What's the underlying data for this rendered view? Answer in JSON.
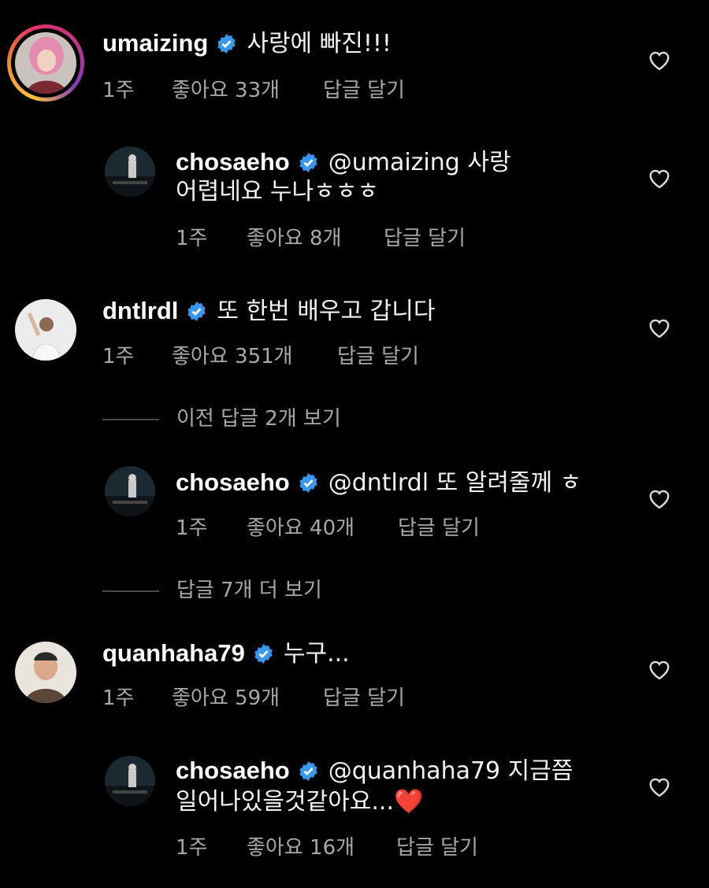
{
  "comments": [
    {
      "username": "umaizing",
      "text": "사랑에 빠진!!!",
      "time": "1주",
      "likes": "좋아요 33개",
      "reply": "답글 달기"
    },
    {
      "username": "chosaeho",
      "text": "@umaizing 사랑",
      "text2": "어렵네요 누나ㅎㅎㅎ",
      "time": "1주",
      "likes": "좋아요 8개",
      "reply": "답글 달기"
    },
    {
      "username": "dntlrdl",
      "text": "또 한번 배우고 갑니다",
      "time": "1주",
      "likes": "좋아요 351개",
      "reply": "답글 달기"
    },
    {
      "username": "chosaeho",
      "text": "@dntlrdl 또 알려줄께 ㅎ",
      "time": "1주",
      "likes": "좋아요 40개",
      "reply": "답글 달기"
    },
    {
      "username": "quanhaha79",
      "text": "누구...",
      "time": "1주",
      "likes": "좋아요 59개",
      "reply": "답글 달기"
    },
    {
      "username": "chosaeho",
      "text": "@quanhaha79 지금쯤",
      "text2": "일어나있을것같아요...❤️",
      "time": "1주",
      "likes": "좋아요 16개",
      "reply": "답글 달기"
    }
  ],
  "view_previous": "이전 답글 2개 보기",
  "view_more": "답글 7개 더 보기",
  "icons": {
    "verified": "verified-badge-icon",
    "like": "heart-outline-icon"
  },
  "colors": {
    "background": "#000000",
    "secondary_text": "#a8a8a8",
    "verified": "#3897f0",
    "heart_emoji": "#e0245e"
  }
}
